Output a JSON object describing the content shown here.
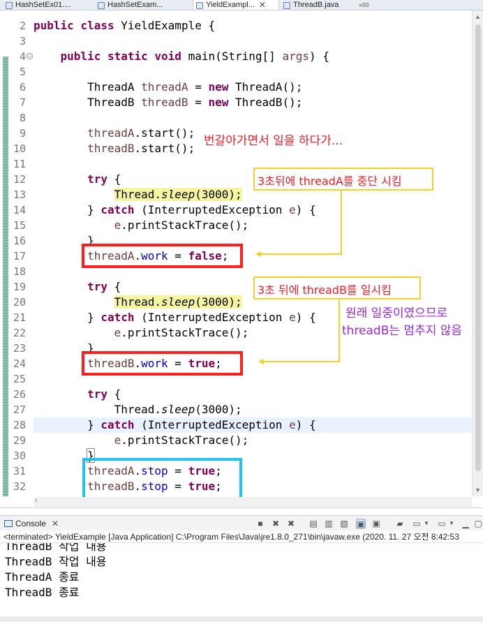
{
  "tabs": [
    {
      "label": "HashSetEx01...."
    },
    {
      "label": "HashSetExam..."
    },
    {
      "label": "YieldExampl..."
    },
    {
      "label": "ThreadB.java"
    },
    {
      "label": "93"
    }
  ],
  "editor": {
    "gutter": [
      "2",
      "3",
      "4",
      "5",
      "6",
      "7",
      "8",
      "9",
      "10",
      "11",
      "12",
      "13",
      "14",
      "15",
      "16",
      "17",
      "18",
      "19",
      "20",
      "21",
      "22",
      "23",
      "24",
      "25",
      "26",
      "27",
      "28",
      "29",
      "30",
      "31",
      "32"
    ],
    "fold_marker": "−"
  },
  "annotations": {
    "note1": "번갈아가면서 일을 하다가...",
    "note2": "3초뒤에 threadA를 중단 시킴",
    "note3": "3초 뒤에 threadB를 일시킴",
    "note4_line1": "원래 일중이였으므로",
    "note4_line2": "threadB는 멈추지 않음",
    "colors": {
      "red": "#ff1f1f",
      "blue": "#21c3f0",
      "yellow": "#f4d128",
      "purple": "#9c27d6",
      "note_red": "#e8202a"
    }
  },
  "console": {
    "tab_label": "Console",
    "terminated": "<terminated> YieldExample [Java Application] C:\\Program Files\\Java\\jre1.8.0_271\\bin\\javaw.exe  (2020. 11. 27 오전 8:42:53",
    "output": [
      "ThreadB 작업 내용",
      "ThreadB 작업 내용",
      "ThreadA 종료",
      "ThreadB 종료"
    ]
  }
}
